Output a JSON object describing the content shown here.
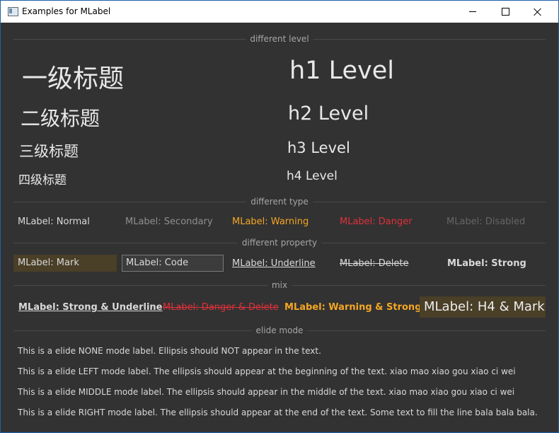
{
  "window": {
    "title": "Examples for MLabel"
  },
  "sections": {
    "level": "different level",
    "type": "different type",
    "property": "different property",
    "mix": "mix",
    "elide": "elide mode"
  },
  "levels": {
    "cn": [
      "一级标题",
      "二级标题",
      "三级标题",
      "四级标题"
    ],
    "en": [
      "h1 Level",
      "h2 Level",
      "h3 Level",
      "h4 Level"
    ]
  },
  "types": {
    "normal": "MLabel: Normal",
    "secondary": "MLabel: Secondary",
    "warning": "MLabel: Warning",
    "danger": "MLabel: Danger",
    "disabled": "MLabel: Disabled"
  },
  "properties": {
    "mark": "MLabel: Mark",
    "code": "MLabel: Code",
    "underline": "MLabel: Underline",
    "delete": "MLabel: Delete",
    "strong": "MLabel: Strong"
  },
  "mix": {
    "strong_underline": "MLabel: Strong & Underline",
    "danger_delete": "MLabel: Danger & Delete",
    "warning_strong": "MLabel: Warning & Strong",
    "h4_mark": "MLabel: H4 & Mark"
  },
  "elide_lines": [
    "This is a elide NONE mode label. Ellipsis should NOT appear in the text.",
    "This is a elide LEFT mode label. The ellipsis should appear at the beginning of the text. xiao mao xiao gou xiao ci wei",
    "This is a elide MIDDLE mode label. The ellipsis should appear in the middle of the text. xiao mao xiao gou xiao ci wei",
    "This is a elide RIGHT mode label. The ellipsis should appear at the end of the text. Some text to fill the line bala bala bala."
  ],
  "colors": {
    "background": "#323232",
    "warning": "#f5a623",
    "danger": "#e0303a",
    "secondary": "#8f8f8f",
    "disabled": "#656565",
    "mark_bg": "#4a3f27"
  },
  "icons": {
    "app": "window-app-icon",
    "minimize": "minimize-icon",
    "maximize": "maximize-icon",
    "close": "close-icon"
  }
}
